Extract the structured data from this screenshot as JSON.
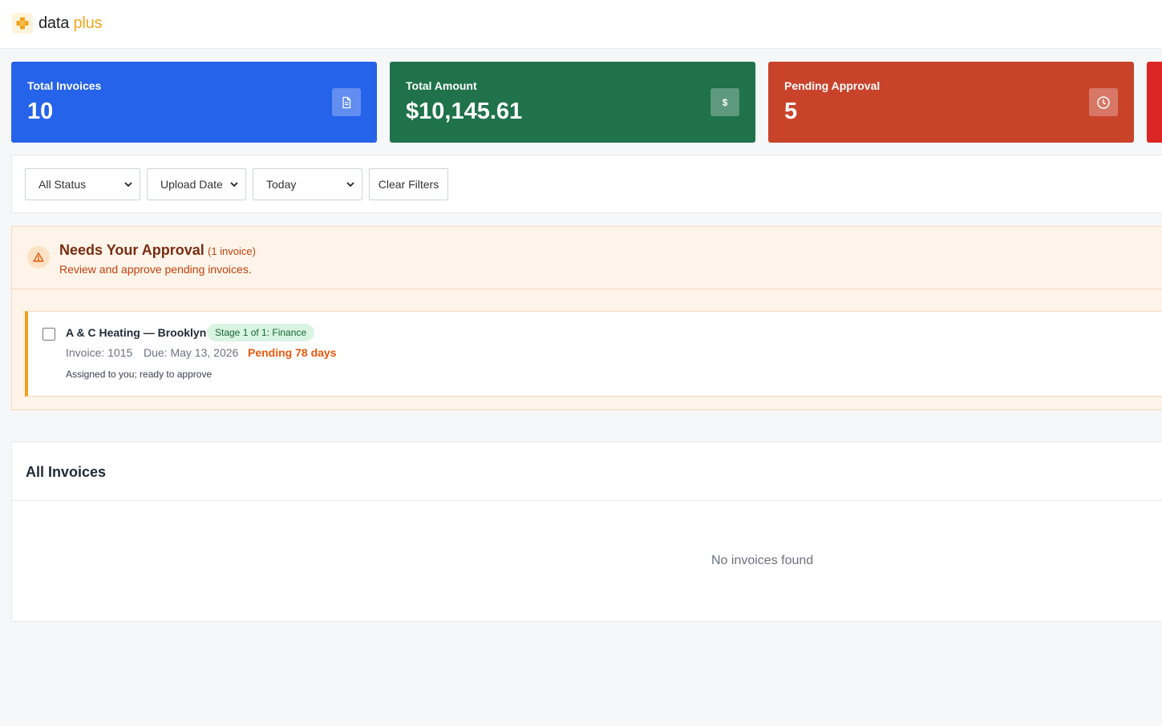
{
  "brand": {
    "name": "data",
    "accent": "plus",
    "accent_color": "#f2a71d"
  },
  "stats": [
    {
      "label": "Total Invoices",
      "value": "10",
      "icon": "document-icon",
      "color": "#2563eb"
    },
    {
      "label": "Total Amount",
      "value": "$10,145.61",
      "icon": "dollar-icon",
      "icon_glyph": "$",
      "color": "#1f724a"
    },
    {
      "label": "Pending Approval",
      "value": "5",
      "icon": "clock-icon",
      "color": "#c9432b"
    }
  ],
  "filters": {
    "status": "All Status",
    "date_field": "Upload Date",
    "date_range": "Today",
    "clear_label": "Clear Filters"
  },
  "approval": {
    "title": "Needs Your Approval",
    "count": "(1 invoice)",
    "subtitle": "Review and approve pending invoices.",
    "items": [
      {
        "vendor": "A & C Heating — Brooklyn",
        "stage": "Stage 1 of 1: Finance",
        "invoice": "Invoice: 1015",
        "due": "Due: May 13, 2026",
        "pending": "Pending 78 days",
        "note": "Assigned to you; ready to approve"
      }
    ]
  },
  "all_invoices": {
    "title": "All Invoices",
    "empty_text": "No invoices found"
  }
}
